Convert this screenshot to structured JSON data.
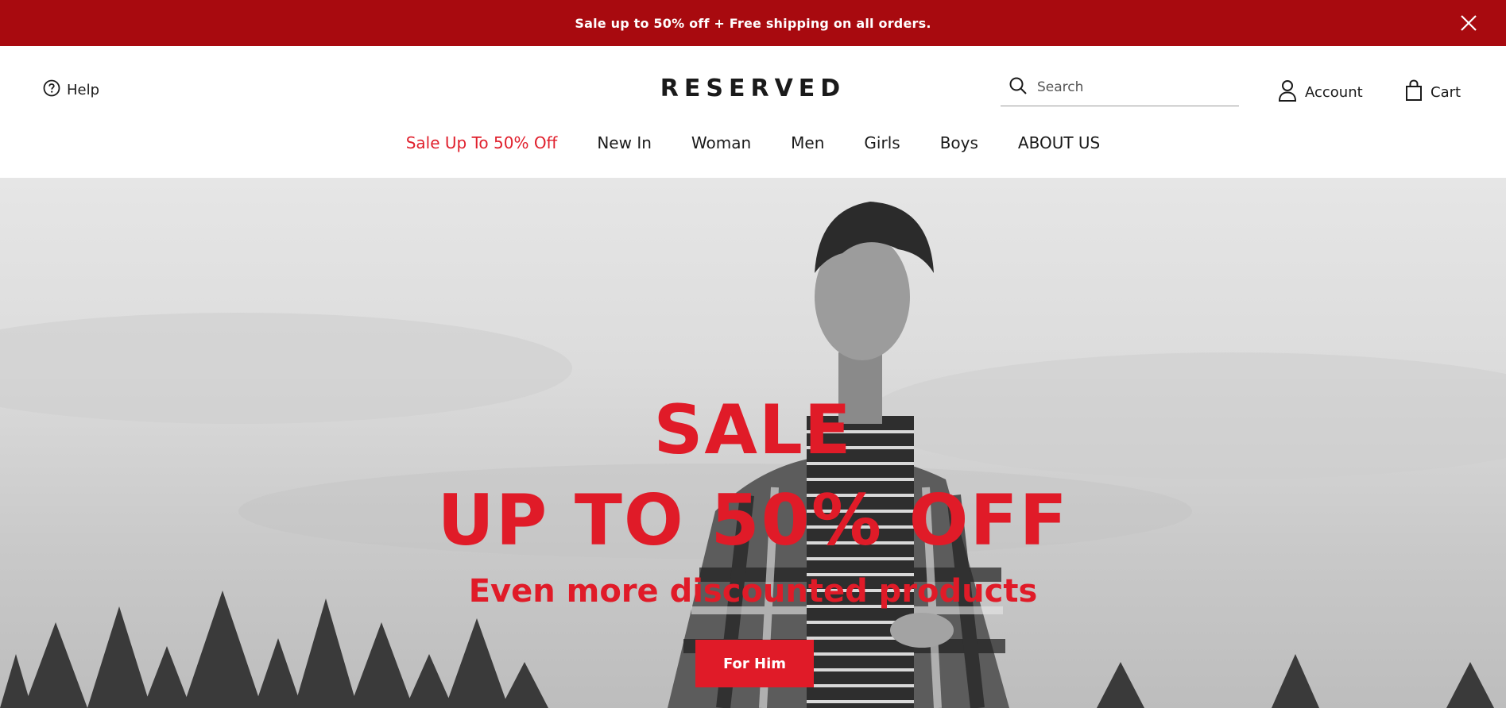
{
  "promo": {
    "text": "Sale up to 50% off + Free shipping on all orders.",
    "close_icon": "close-icon"
  },
  "header": {
    "help_label": "Help",
    "logo": "RESERVED",
    "search_placeholder": "Search",
    "account_label": "Account",
    "cart_label": "Cart"
  },
  "nav": {
    "items": [
      {
        "label": "Sale Up To 50% Off"
      },
      {
        "label": "New In"
      },
      {
        "label": "Woman"
      },
      {
        "label": "Men"
      },
      {
        "label": "Girls"
      },
      {
        "label": "Boys"
      },
      {
        "label": "ABOUT US"
      }
    ]
  },
  "hero": {
    "title": "SALE",
    "subtitle": "UP TO 50% OFF",
    "tagline": "Even more discounted products",
    "button_label": "For Him"
  },
  "colors": {
    "promo_bg": "#a80a0f",
    "accent": "#e01b28"
  }
}
